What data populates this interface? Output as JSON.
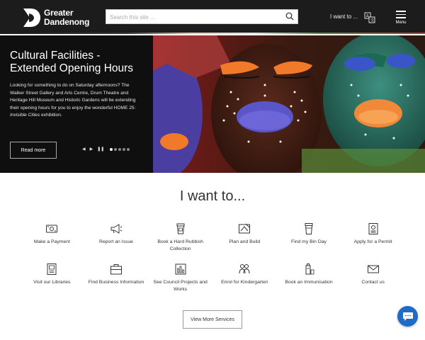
{
  "header": {
    "logo_line1": "Greater",
    "logo_line2": "Dandenong",
    "search_placeholder": "Search this site ...",
    "iwant_label": "I want to ...",
    "menu_label": "Menu"
  },
  "hero": {
    "title": "Cultural Facilities - Extended Opening Hours",
    "body_prefix": "Looking for something to do on Saturday afternoons? The Walker Street Gallery and Arts Centre, Drum Theatre and Heritage Hill Museum and Historic Gardens will be extending their opening hours for you to enjoy the wonderful HOME 25:",
    "body_italic": "Invisible Cities",
    "body_suffix": "exhibition.",
    "read_more": "Read more",
    "slide_count": 5,
    "active_slide": 1
  },
  "iwant": {
    "title": "I want to...",
    "services": [
      {
        "label": "Make a Payment",
        "icon": "payment-icon"
      },
      {
        "label": "Report an Issue",
        "icon": "megaphone-icon"
      },
      {
        "label": "Book a Hard Rubbish Collection",
        "icon": "rubbish-bin-icon"
      },
      {
        "label": "Plan and Build",
        "icon": "blueprint-icon"
      },
      {
        "label": "Find my Bin Day",
        "icon": "bin-icon"
      },
      {
        "label": "Apply for a Permit",
        "icon": "permit-icon"
      },
      {
        "label": "Visit our Libraries",
        "icon": "library-icon"
      },
      {
        "label": "Find Business Information",
        "icon": "briefcase-icon"
      },
      {
        "label": "See Council Projects and Works",
        "icon": "projects-icon"
      },
      {
        "label": "Enrol for Kindergarten",
        "icon": "kindergarten-icon"
      },
      {
        "label": "Book an Immunisation",
        "icon": "immunisation-icon"
      },
      {
        "label": "Contact us",
        "icon": "envelope-icon"
      }
    ],
    "view_more": "View More Services"
  },
  "colors": {
    "header_bg": "#1c1c1c",
    "chat_blue": "#1e6cc8"
  }
}
